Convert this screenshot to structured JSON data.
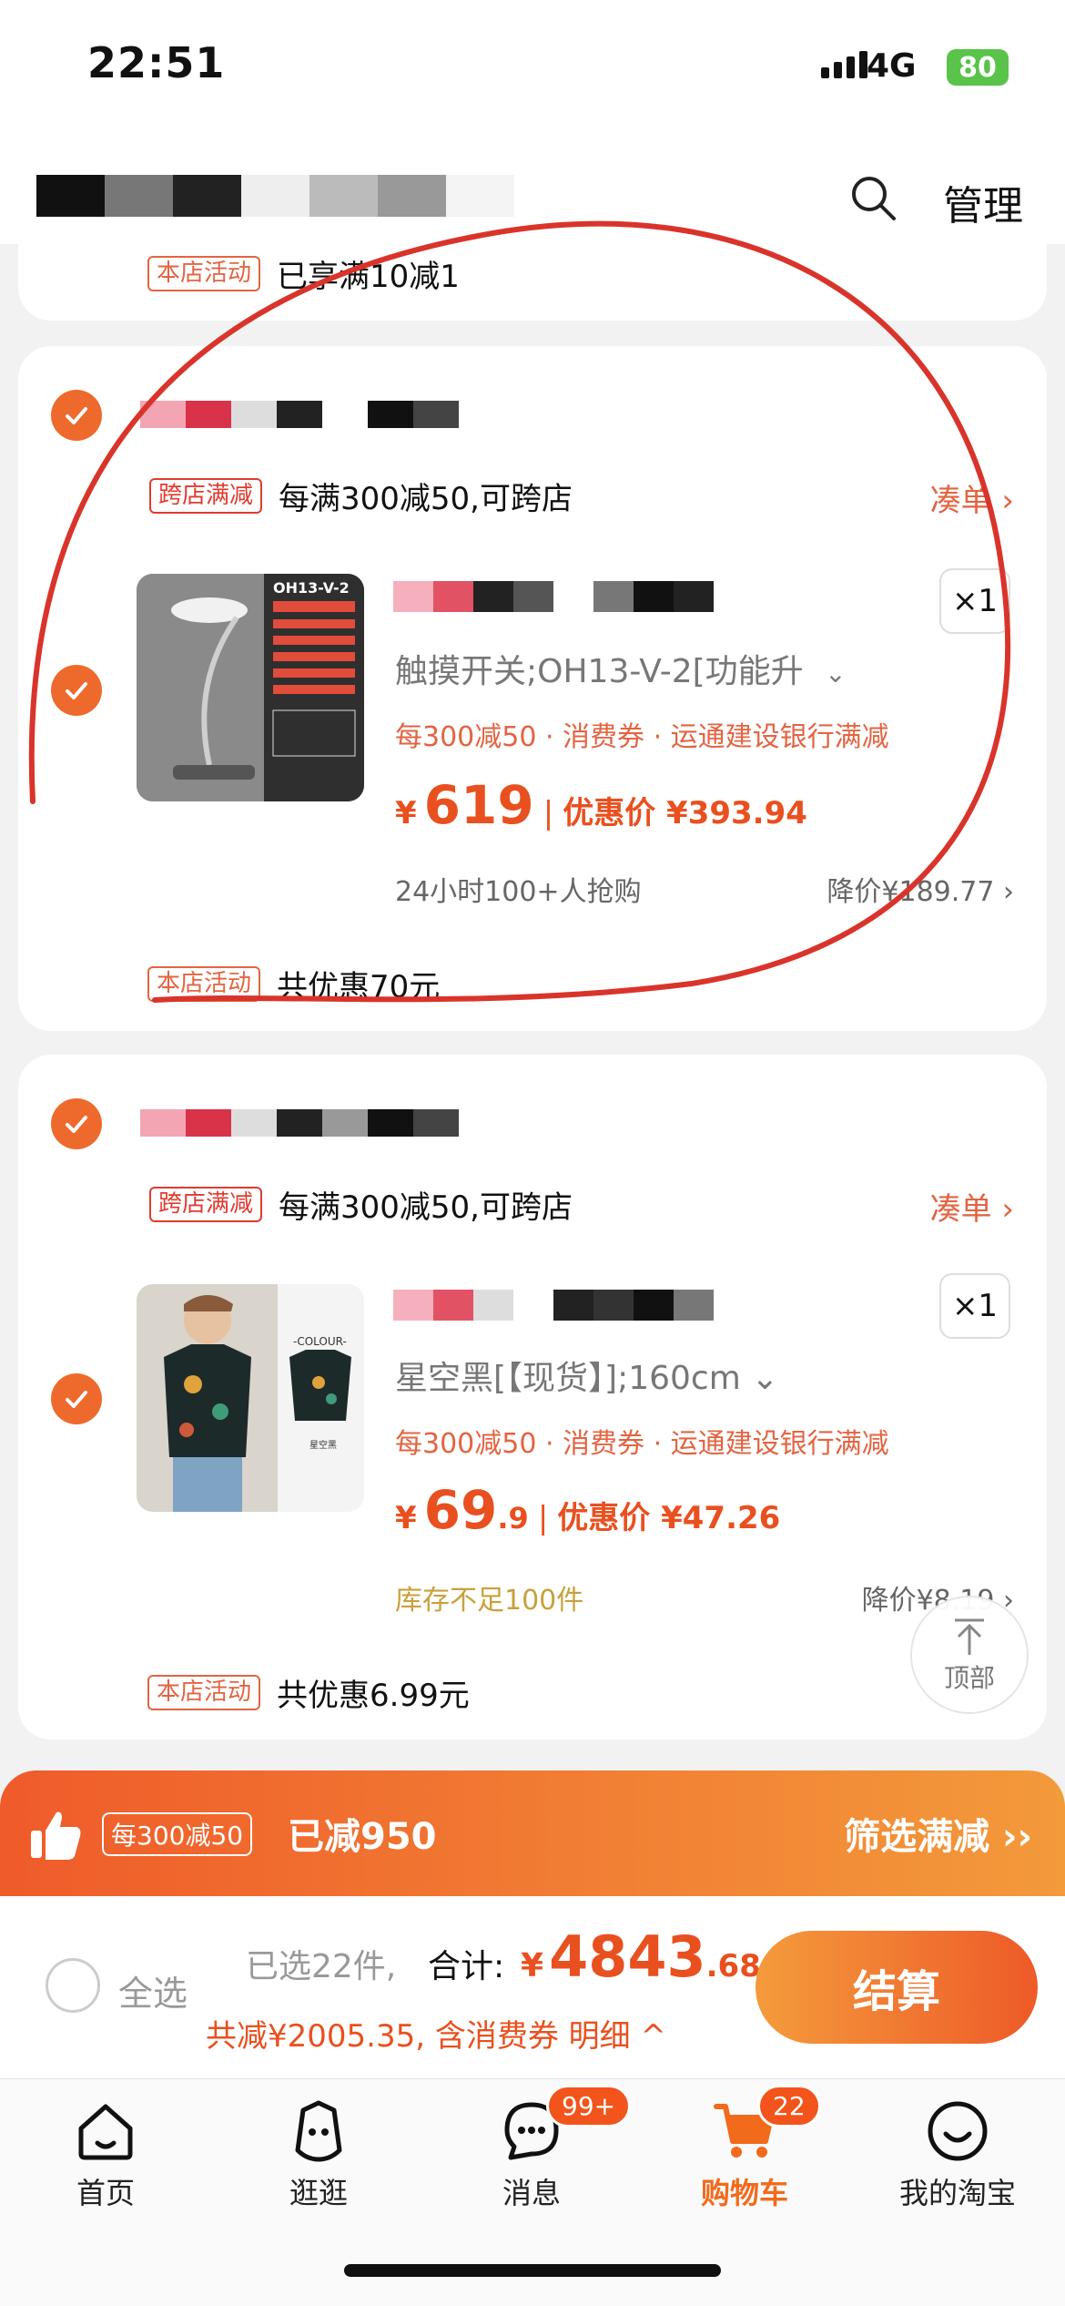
{
  "status_bar": {
    "time": "22:51",
    "network": "4G",
    "battery": "80"
  },
  "header": {
    "manage_label": "管理",
    "search_icon": "search-icon"
  },
  "store_activity_top": {
    "tag": "本店活动",
    "text": "已享满10减1"
  },
  "shops": [
    {
      "cross_tag": "跨店满减",
      "cross_text": "每满300减50,可跨店",
      "collect_label": "凑单 ›",
      "item": {
        "thumb_caption": "OH13-V-2",
        "sku": "触摸开关;OH13-V-2[功能升",
        "promo": "每300减50 · 消费券 · 运通建设银行满减",
        "currency": "¥",
        "price_int": "619",
        "price_dec": "",
        "discount_label": "优惠价 ¥393.94",
        "qty": "×1",
        "note": "24小时100+人抢购",
        "drop": "降价¥189.77 ›"
      },
      "activity_tag": "本店活动",
      "activity_text": "共优惠70元"
    },
    {
      "cross_tag": "跨店满减",
      "cross_text": "每满300减50,可跨店",
      "collect_label": "凑单 ›",
      "item": {
        "thumb_caption": "-COLOUR-",
        "thumb_sub": "星空黑",
        "sku": "星空黑[【现货】];160cm ⌄",
        "promo": "每300减50 · 消费券 · 运通建设银行满减",
        "currency": "¥",
        "price_int": "69",
        "price_dec": ".9",
        "discount_label": "优惠价 ¥47.26",
        "qty": "×1",
        "note": "库存不足100件",
        "drop": "降价¥8.19 ›"
      },
      "activity_tag": "本店活动",
      "activity_text": "共优惠6.99元"
    }
  ],
  "back_to_top": "顶部",
  "banner": {
    "tag": "每300减50",
    "saved": "已减950",
    "filter": "筛选满减 ››"
  },
  "checkout": {
    "select_all": "全选",
    "selected": "已选22件,",
    "total_label": "合计:",
    "currency": "¥",
    "total_int": "4843",
    "total_dec": ".68",
    "saved_line": "共减¥2005.35, 含消费券 明细 ^",
    "pay_label": "结算"
  },
  "tabs": [
    {
      "label": "首页",
      "icon": "home-icon"
    },
    {
      "label": "逛逛",
      "icon": "explore-icon"
    },
    {
      "label": "消息",
      "icon": "message-icon",
      "badge": "99+"
    },
    {
      "label": "购物车",
      "icon": "cart-icon",
      "badge": "22",
      "active": true
    },
    {
      "label": "我的淘宝",
      "icon": "profile-icon"
    }
  ],
  "colors": {
    "accent": "#ee6a2c",
    "price": "#e9501f",
    "annotation": "#d9342b"
  }
}
